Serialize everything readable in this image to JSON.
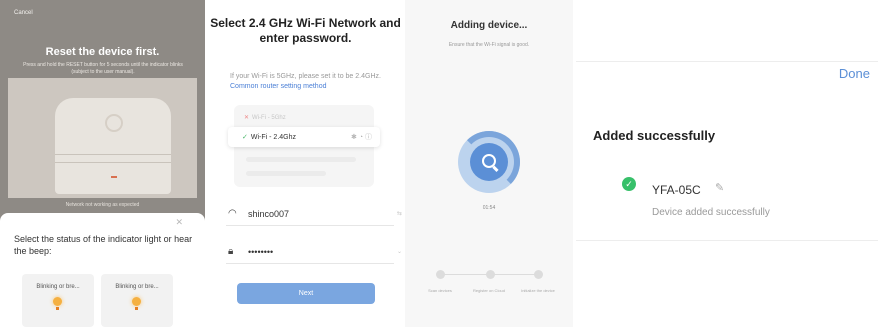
{
  "reset_screen": {
    "cancel_label": "Cancel",
    "title": "Reset the device first.",
    "description": "Press and hold the RESET button for 5 seconds until the indicator blinks (subject to the user manual).",
    "caption": "Network not working as expected",
    "close_icon": "close-icon",
    "question": "Select the status of the indicator light or hear the beep:",
    "options": [
      {
        "label": "Blinking or bre...",
        "icon": "light-bulb-icon"
      },
      {
        "label": "Blinking or bre...",
        "icon": "light-bulb-icon"
      }
    ]
  },
  "wifi_screen": {
    "title": "Select 2.4 GHz Wi-Fi Network and enter password.",
    "note": "If your Wi-Fi is 5GHz, please set it to be 2.4GHz.",
    "note_link": "Common router setting method",
    "network_5g": "Wi-Fi - 5Ghz",
    "network_24g": "Wi-Fi - 2.4Ghz",
    "ssid_value": "shinco007",
    "password_value": "••••••••",
    "next_label": "Next",
    "wifi_icon": "wifi-icon",
    "lock_icon": "lock-icon"
  },
  "adding_screen": {
    "title": "Adding device...",
    "subtitle": "Ensure that the Wi-Fi signal is good.",
    "timer": "01:54",
    "steps": [
      "Scan devices",
      "Register on Cloud",
      "Initialize the device"
    ],
    "progress_icon": "search-icon"
  },
  "success_screen": {
    "done_label": "Done",
    "heading": "Added successfully",
    "device_name": "YFA-05C",
    "device_status": "Device added successfully",
    "check_icon": "check-circle-icon",
    "edit_icon": "pencil-icon",
    "accent_color": "#5b8fd6",
    "success_color": "#37c06a"
  }
}
